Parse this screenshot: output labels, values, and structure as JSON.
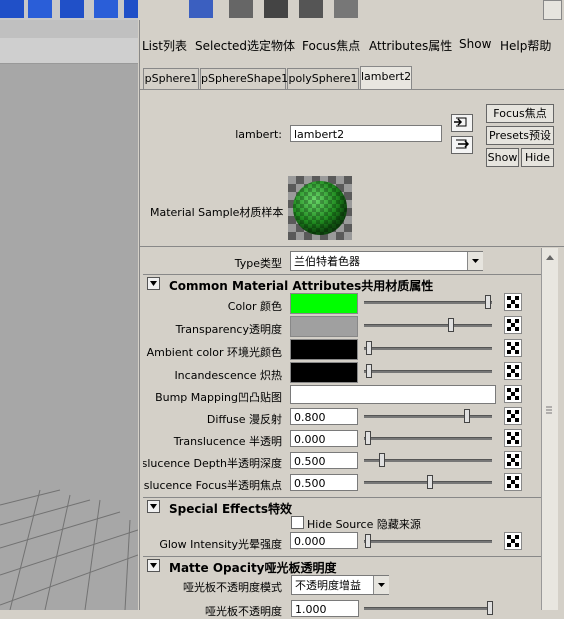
{
  "menu": [
    "List列表",
    "Selected选定物体",
    "Focus焦点",
    "Attributes属性",
    "Show",
    "Help帮助"
  ],
  "tabs": [
    "pSphere1",
    "pSphereShape1",
    "polySphere1",
    "lambert2"
  ],
  "active_tab": 3,
  "node": {
    "label": "lambert:",
    "value": "lambert2"
  },
  "buttons": {
    "focus": "Focus焦点",
    "presets": "Presets预设",
    "show": "Show",
    "hide": "Hide"
  },
  "sample": {
    "label": "Material Sample材质样本"
  },
  "type_row": {
    "label": "Type类型",
    "value": "兰伯特着色器"
  },
  "sections": {
    "common": "Common Material Attributes共用材质属性",
    "special": "Special Effects特效",
    "matte": "Matte Opacity哑光板透明度"
  },
  "attributes": {
    "color": {
      "label": "Color 颜色",
      "swatch": "#00ff00",
      "level": 0.98
    },
    "transparency": {
      "label": "Transparency透明度",
      "swatch": "#a0a0a0",
      "level": 0.68
    },
    "ambient": {
      "label": "Ambient color 环境光颜色",
      "swatch": "#000000",
      "level": 0.02
    },
    "incandescence": {
      "label": "Incandescence 炽热",
      "swatch": "#000000",
      "level": 0.02
    },
    "bump": {
      "label": "Bump Mapping凹凸贴图"
    },
    "diffuse": {
      "label": "Diffuse 漫反射",
      "value": "0.800"
    },
    "translucence": {
      "label": "Translucence 半透明",
      "value": "0.000"
    },
    "trans_depth": {
      "label": "anslucence Depth半透明深度",
      "value": "0.500"
    },
    "trans_focus": {
      "label": "anslucence Focus半透明焦点",
      "value": "0.500"
    }
  },
  "special": {
    "hide_source": "Hide Source 隐藏来源",
    "glow_label": "Glow Intensity光晕强度",
    "glow_value": "0.000"
  },
  "matte": {
    "mode_label": "哑光板不透明度模式",
    "mode_value": "不透明度增益",
    "opacity_label": "哑光板不透明度",
    "opacity_value": "1.000"
  }
}
